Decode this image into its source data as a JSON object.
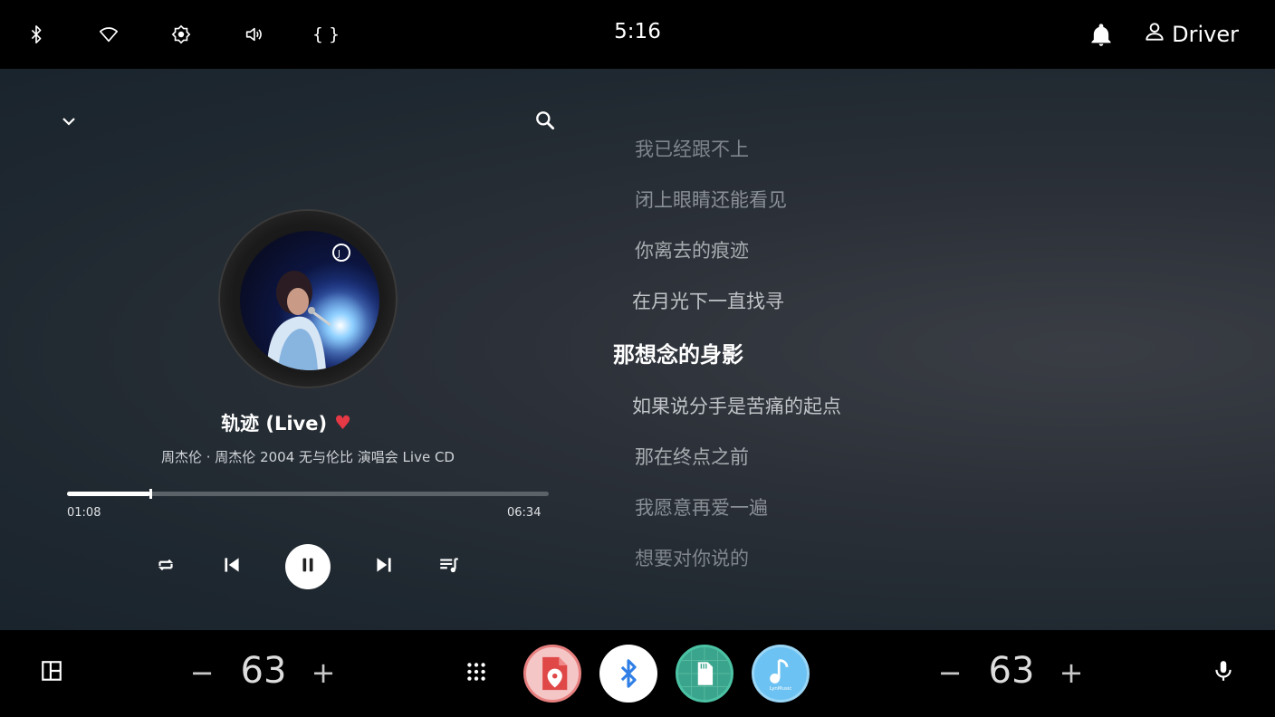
{
  "status_bar": {
    "clock": "5:16",
    "user_label": "Driver",
    "icons": [
      "bluetooth-icon",
      "wifi-icon",
      "brightness-icon",
      "volume-icon",
      "debug-icon",
      "notification-icon",
      "person-icon"
    ],
    "debug_glyph": "{ }"
  },
  "player": {
    "title": "轨迹 (Live)",
    "subtitle": "周杰伦 · 周杰伦 2004 无与伦比 演唱会 Live CD",
    "current_time": "01:08",
    "total_time": "06:34",
    "progress_fraction": 0.173,
    "favorited": true,
    "heart_glyph": "♥",
    "controls": [
      "repeat-icon",
      "previous-icon",
      "pause-icon",
      "next-icon",
      "queue-icon"
    ]
  },
  "lyrics": {
    "lines": [
      "我已经跟不上",
      "闭上眼睛还能看见",
      "你离去的痕迹",
      "在月光下一直找寻",
      "那想念的身影",
      "如果说分手是苦痛的起点",
      "那在终点之前",
      "我愿意再爱一遍",
      "想要对你说的"
    ],
    "active_index": 4
  },
  "dock": {
    "left_volume": "63",
    "right_volume": "63",
    "minus_glyph": "−",
    "plus_glyph": "+",
    "apps": [
      "maps-app-icon",
      "bluetooth-app-icon",
      "sdcard-app-icon",
      "lynmusic-app-icon"
    ],
    "lynmusic_label": "LynMusic"
  },
  "colors": {
    "heart": "#e53945",
    "progress_fill": "#ffffff",
    "progress_track": "#5b6268"
  }
}
